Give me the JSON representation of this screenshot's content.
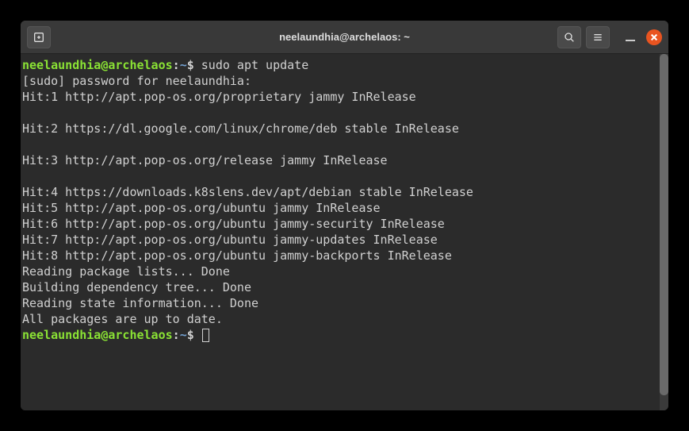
{
  "titlebar": {
    "title": "neelaundhia@archelaos: ~"
  },
  "prompt": {
    "user_host": "neelaundhia@archelaos",
    "colon": ":",
    "path": "~",
    "symbol": "$"
  },
  "command": "sudo apt update",
  "output_lines": [
    "[sudo] password for neelaundhia:",
    "Hit:1 http://apt.pop-os.org/proprietary jammy InRelease",
    "",
    "Hit:2 https://dl.google.com/linux/chrome/deb stable InRelease",
    "",
    "Hit:3 http://apt.pop-os.org/release jammy InRelease",
    "",
    "Hit:4 https://downloads.k8slens.dev/apt/debian stable InRelease",
    "Hit:5 http://apt.pop-os.org/ubuntu jammy InRelease",
    "Hit:6 http://apt.pop-os.org/ubuntu jammy-security InRelease",
    "Hit:7 http://apt.pop-os.org/ubuntu jammy-updates InRelease",
    "Hit:8 http://apt.pop-os.org/ubuntu jammy-backports InRelease",
    "Reading package lists... Done",
    "Building dependency tree... Done",
    "Reading state information... Done",
    "All packages are up to date."
  ]
}
